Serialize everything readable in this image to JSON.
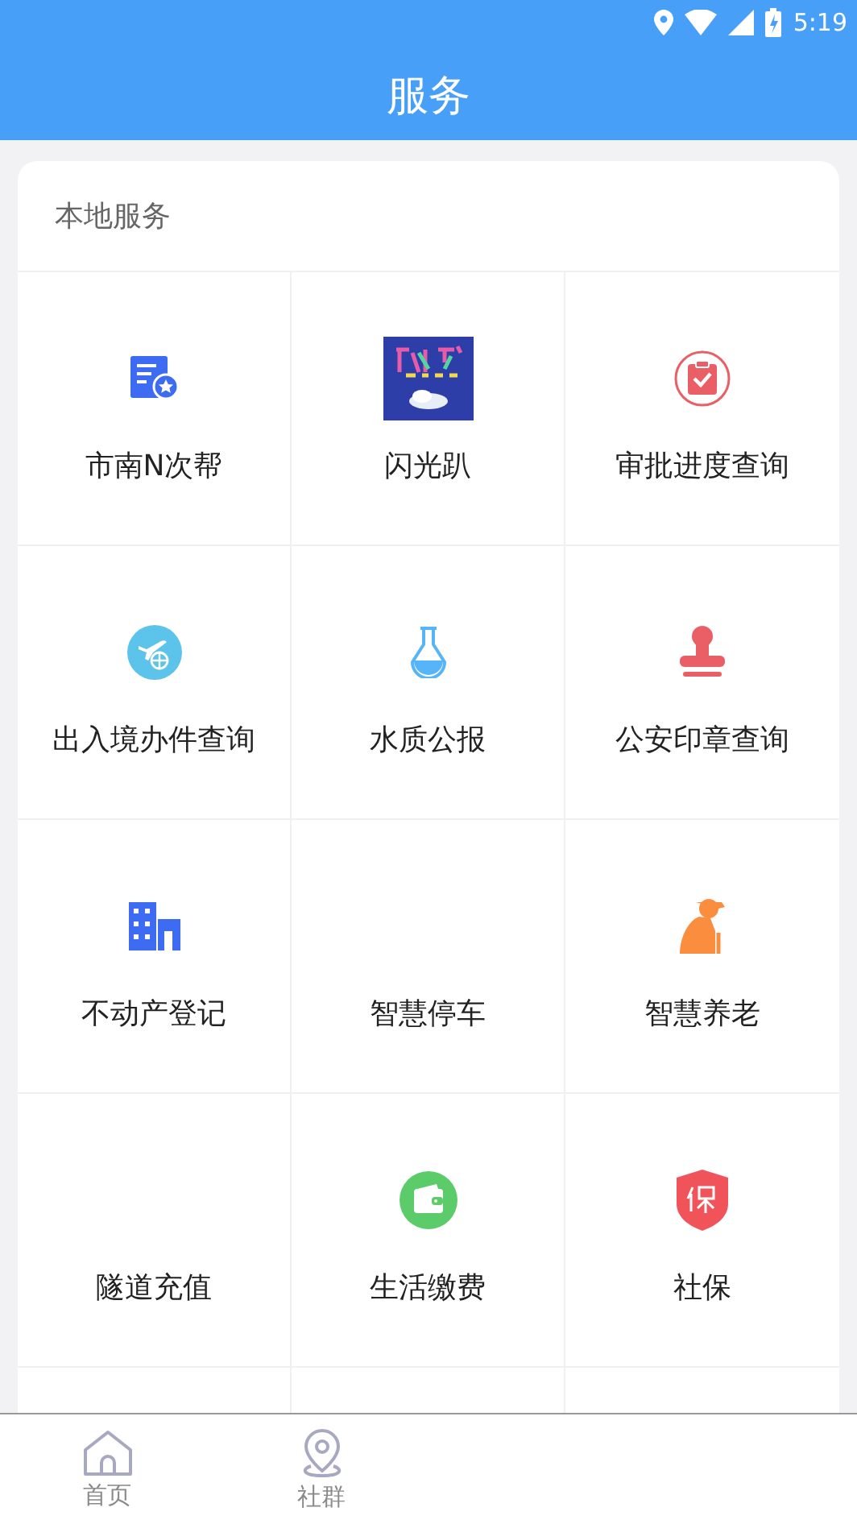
{
  "status_bar": {
    "time": "5:19"
  },
  "header": {
    "title": "服务"
  },
  "section": {
    "title": "本地服务",
    "items": [
      {
        "label": "市南N次帮",
        "kind": "icon"
      },
      {
        "label": "闪光趴",
        "kind": "picture"
      },
      {
        "label": "审批进度查询",
        "kind": "icon"
      },
      {
        "label": "出入境办件查询",
        "kind": "icon"
      },
      {
        "label": "水质公报",
        "kind": "icon"
      },
      {
        "label": "公安印章查询",
        "kind": "icon"
      },
      {
        "label": "不动产登记",
        "kind": "icon"
      },
      {
        "label": "智慧停车",
        "kind": "none"
      },
      {
        "label": "智慧养老",
        "kind": "icon"
      },
      {
        "label": "隧道充值",
        "kind": "none"
      },
      {
        "label": "生活缴费",
        "kind": "icon"
      },
      {
        "label": "社保",
        "kind": "icon"
      }
    ]
  },
  "tab_bar": [
    {
      "label": "首页",
      "selected": false
    },
    {
      "label": "社群",
      "selected": false
    }
  ]
}
